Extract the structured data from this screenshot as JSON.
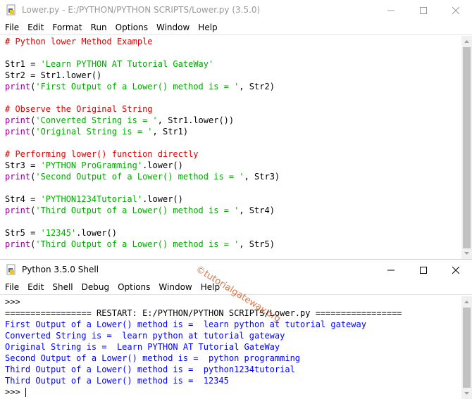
{
  "editor": {
    "title": "Lower.py - E:/PYTHON/PYTHON SCRIPTS/Lower.py (3.5.0)",
    "menu": [
      "File",
      "Edit",
      "Format",
      "Run",
      "Options",
      "Window",
      "Help"
    ],
    "code": [
      [
        {
          "t": "cm",
          "v": "# Python lower Method Example"
        }
      ],
      [],
      [
        {
          "t": "plain",
          "v": "Str1 = "
        },
        {
          "t": "str",
          "v": "'Learn PYTHON AT Tutorial GateWay'"
        }
      ],
      [
        {
          "t": "plain",
          "v": "Str2 = Str1.lower()"
        }
      ],
      [
        {
          "t": "bi",
          "v": "print"
        },
        {
          "t": "plain",
          "v": "("
        },
        {
          "t": "str",
          "v": "'First Output of a Lower() method is = '"
        },
        {
          "t": "plain",
          "v": ", Str2)"
        }
      ],
      [],
      [
        {
          "t": "cm",
          "v": "# Observe the Original String"
        }
      ],
      [
        {
          "t": "bi",
          "v": "print"
        },
        {
          "t": "plain",
          "v": "("
        },
        {
          "t": "str",
          "v": "'Converted String is = '"
        },
        {
          "t": "plain",
          "v": ", Str1.lower())"
        }
      ],
      [
        {
          "t": "bi",
          "v": "print"
        },
        {
          "t": "plain",
          "v": "("
        },
        {
          "t": "str",
          "v": "'Original String is = '"
        },
        {
          "t": "plain",
          "v": ", Str1)"
        }
      ],
      [],
      [
        {
          "t": "cm",
          "v": "# Performing lower() function directly"
        }
      ],
      [
        {
          "t": "plain",
          "v": "Str3 = "
        },
        {
          "t": "str",
          "v": "'PYTHON ProGramming'"
        },
        {
          "t": "plain",
          "v": ".lower()"
        }
      ],
      [
        {
          "t": "bi",
          "v": "print"
        },
        {
          "t": "plain",
          "v": "("
        },
        {
          "t": "str",
          "v": "'Second Output of a Lower() method is = '"
        },
        {
          "t": "plain",
          "v": ", Str3)"
        }
      ],
      [],
      [
        {
          "t": "plain",
          "v": "Str4 = "
        },
        {
          "t": "str",
          "v": "'PYTHON1234Tutorial'"
        },
        {
          "t": "plain",
          "v": ".lower()"
        }
      ],
      [
        {
          "t": "bi",
          "v": "print"
        },
        {
          "t": "plain",
          "v": "("
        },
        {
          "t": "str",
          "v": "'Third Output of a Lower() method is = '"
        },
        {
          "t": "plain",
          "v": ", Str4)"
        }
      ],
      [],
      [
        {
          "t": "plain",
          "v": "Str5 = "
        },
        {
          "t": "str",
          "v": "'12345'"
        },
        {
          "t": "plain",
          "v": ".lower()"
        }
      ],
      [
        {
          "t": "bi",
          "v": "print"
        },
        {
          "t": "plain",
          "v": "("
        },
        {
          "t": "str",
          "v": "'Third Output of a Lower() method is = '"
        },
        {
          "t": "plain",
          "v": ", Str5)"
        }
      ]
    ]
  },
  "shell": {
    "title": "Python 3.5.0 Shell",
    "menu": [
      "File",
      "Edit",
      "Shell",
      "Debug",
      "Options",
      "Window",
      "Help"
    ],
    "lines": [
      {
        "t": "plain",
        "v": ">>>"
      },
      {
        "t": "plain",
        "v": "================= RESTART: E:/PYTHON/PYTHON SCRIPTS/Lower.py ================="
      },
      {
        "t": "out",
        "v": "First Output of a Lower() method is =  learn python at tutorial gateway"
      },
      {
        "t": "out",
        "v": "Converted String is =  learn python at tutorial gateway"
      },
      {
        "t": "out",
        "v": "Original String is =  Learn PYTHON AT Tutorial GateWay"
      },
      {
        "t": "out",
        "v": "Second Output of a Lower() method is =  python programming"
      },
      {
        "t": "out",
        "v": "Third Output of a Lower() method is =  python1234tutorial"
      },
      {
        "t": "out",
        "v": "Third Output of a Lower() method is =  12345"
      }
    ],
    "prompt": ">>> "
  },
  "watermark": "©tutorialgateway.org",
  "colors": {
    "keyword": "#900090",
    "string": "#00aa00",
    "comment": "#dd0000",
    "output": "#0000ff"
  }
}
